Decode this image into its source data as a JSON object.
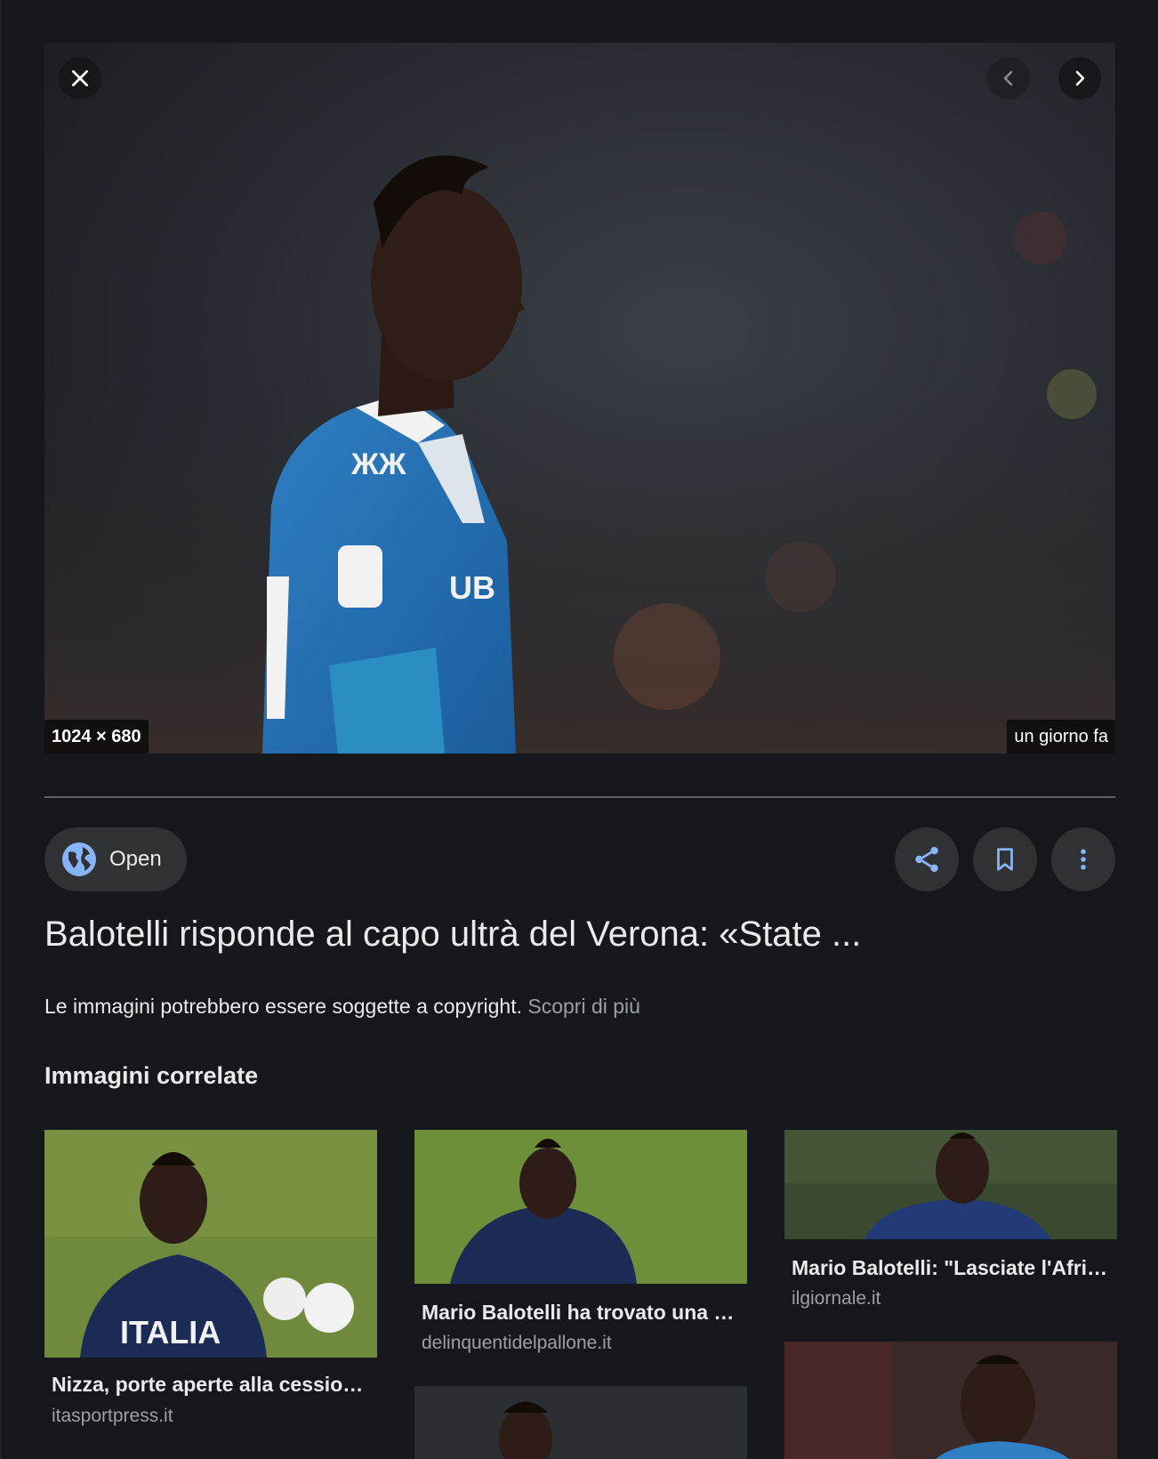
{
  "viewer": {
    "image_size": "1024 × 680",
    "date": "un giorno fa"
  },
  "actions": {
    "open_label": "Open"
  },
  "result": {
    "title": "Balotelli risponde al capo ultrà del Verona: «State ...",
    "copyright_text": "Le immagini potrebbero essere soggette a copyright.",
    "learn_more": "Scopri di più"
  },
  "related": {
    "heading": "Immagini correlate",
    "cards": [
      {
        "caption": "Nizza, porte aperte alla cessione…",
        "source": "itasportpress.it"
      },
      {
        "caption": "Mario Balotelli ha trovato una …",
        "source": "delinquentidelpallone.it"
      },
      {
        "caption": "Mario Balotelli: \"Lasciate l'Afri…",
        "source": "ilgiornale.it"
      }
    ]
  },
  "colors": {
    "background": "#15171c",
    "button_bg": "#303134",
    "accent_blue": "#8ab4f8",
    "muted_text": "#9aa0a6"
  }
}
